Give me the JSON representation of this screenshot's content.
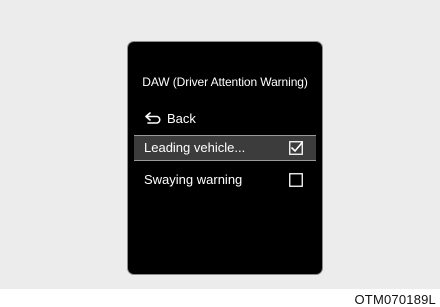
{
  "screen": {
    "title": "DAW (Driver Attention Warning)",
    "back_label": "Back",
    "back_icon": "back-arrow-icon",
    "items": [
      {
        "label": "Leading vehicle...",
        "checked": true,
        "selected": true
      },
      {
        "label": "Swaying warning",
        "checked": false,
        "selected": false
      }
    ]
  },
  "caption": "OTM070189L",
  "colors": {
    "background": "#ececec",
    "screen": "#000000",
    "selected_row": "#3c3c3c",
    "text": "#ffffff"
  }
}
